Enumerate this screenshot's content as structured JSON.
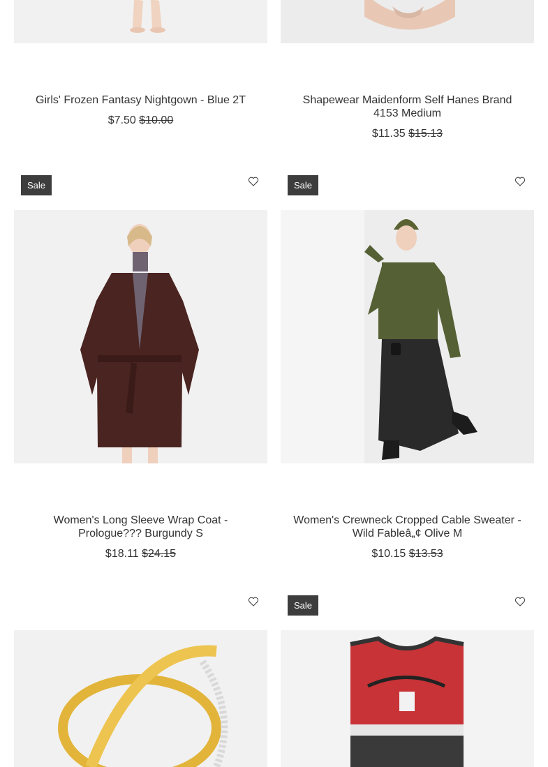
{
  "products": [
    {
      "title": "Girls' Frozen Fantasy Nightgown - Blue 2T",
      "price": "$7.50",
      "old_price": "$10.00"
    },
    {
      "title": "Shapewear Maidenform Self Hanes Brand 4153 Medium",
      "price": "$11.35",
      "old_price": "$15.13"
    },
    {
      "badge": "Sale",
      "title": "Women's Long Sleeve Wrap Coat - Prologue??? Burgundy S",
      "price": "$18.11",
      "old_price": "$24.15"
    },
    {
      "badge": "Sale",
      "title": "Women's Crewneck Cropped Cable Sweater - Wild Fableâ„¢ Olive M",
      "price": "$10.15",
      "old_price": "$13.53"
    },
    {},
    {
      "badge": "Sale"
    }
  ],
  "icons": {
    "wishlist": "heart-outline-icon"
  },
  "colors": {
    "badge_bg": "#3d3d3d",
    "image_bg": "#f1f1f1",
    "text": "#333333"
  }
}
